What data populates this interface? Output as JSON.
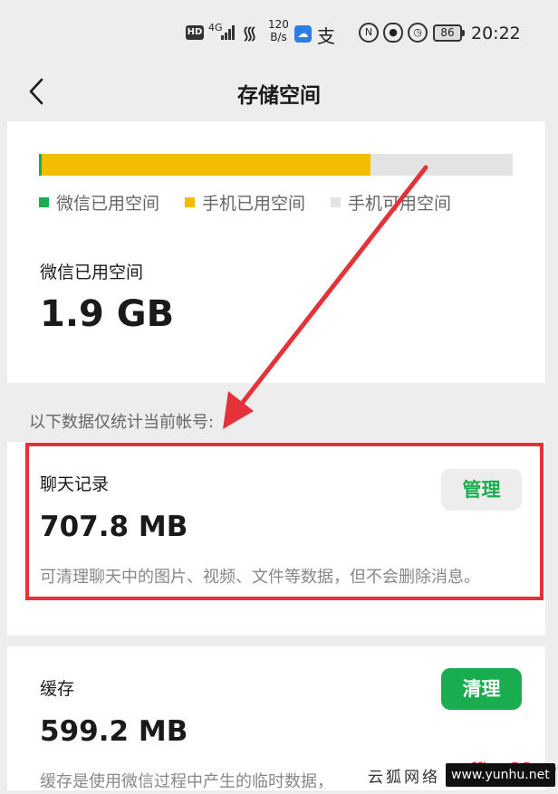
{
  "status_bar": {
    "hd": "HD",
    "signal": "4G",
    "speed_value": "120",
    "speed_unit": "B/s",
    "app2": "支",
    "battery": "86",
    "time": "20:22"
  },
  "nav": {
    "title": "存储空间"
  },
  "storage": {
    "wechat_fraction": 0.006,
    "phone_fraction": 0.7,
    "legend": [
      {
        "label": "微信已用空间",
        "color": "#1aad4f"
      },
      {
        "label": "手机已用空间",
        "color": "#f3bd00"
      },
      {
        "label": "手机可用空间",
        "color": "#e3e3e3"
      }
    ],
    "used_label": "微信已用空间",
    "used_value": "1.9 GB"
  },
  "section_note": "以下数据仅统计当前帐号:",
  "chat": {
    "title": "聊天记录",
    "value": "707.8 MB",
    "button": "管理",
    "desc": "可清理聊天中的图片、视频、文件等数据，但不会删除消息。"
  },
  "cache": {
    "title": "缓存",
    "value": "599.2 MB",
    "button": "清理",
    "desc": "缓存是使用微信过程中产生的临时数据，"
  },
  "watermark": {
    "text": "云狐网络",
    "red": "office66.cn",
    "url": "www.yunhu.net"
  },
  "colors": {
    "accent": "#1aad4f",
    "highlight": "#e53238",
    "yellow": "#f3bd00"
  }
}
